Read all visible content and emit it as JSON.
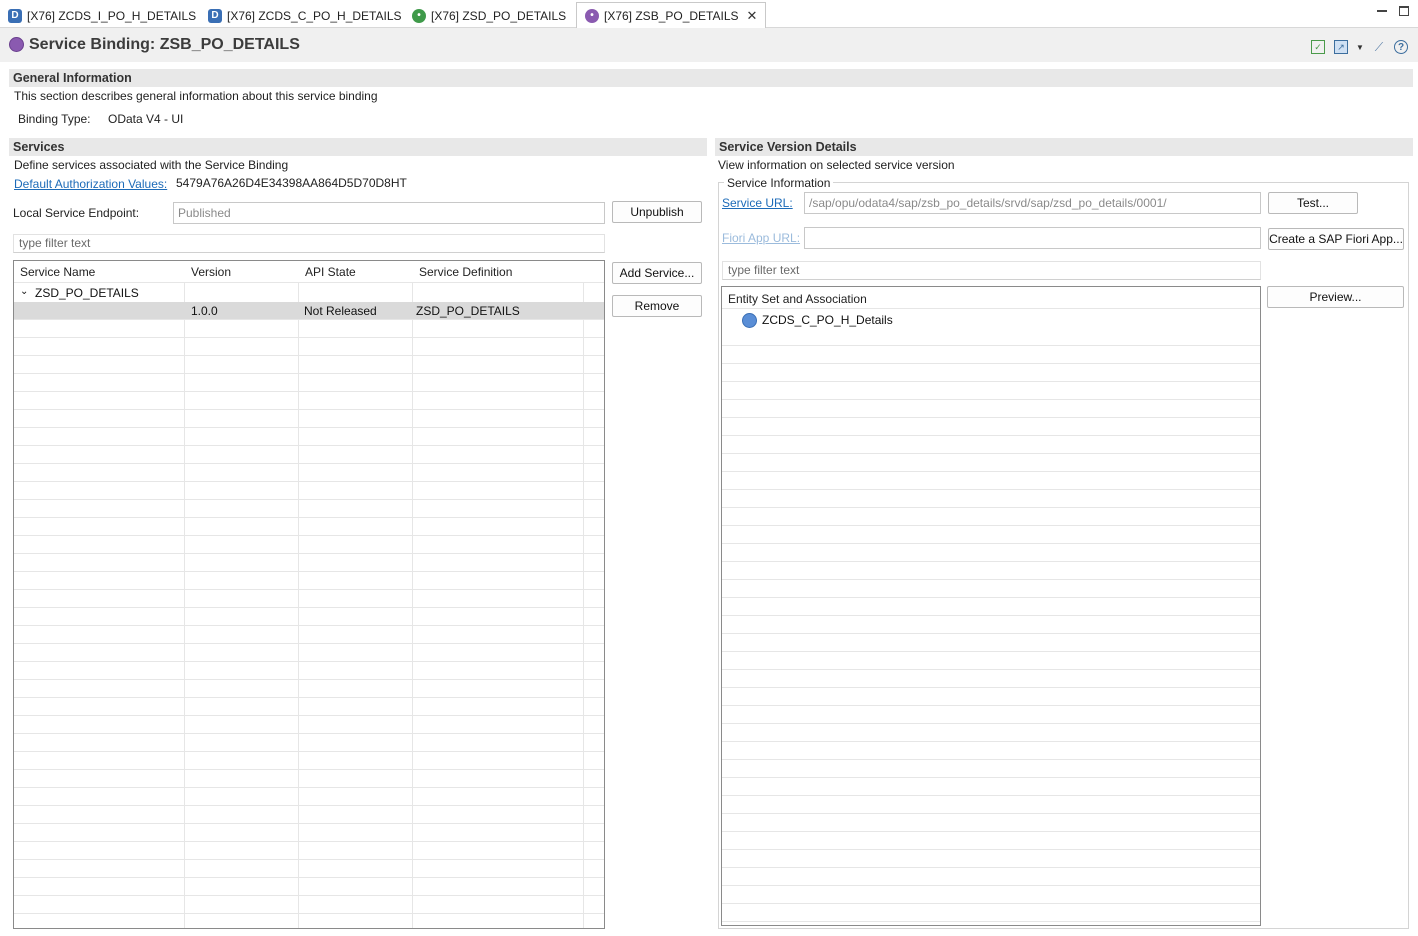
{
  "tabs": [
    {
      "icon": "d",
      "label": "[X76] ZCDS_I_PO_H_DETAILS"
    },
    {
      "icon": "d",
      "label": "[X76] ZCDS_C_PO_H_DETAILS"
    },
    {
      "icon": "g",
      "label": "[X76] ZSD_PO_DETAILS"
    },
    {
      "icon": "p",
      "label": "[X76] ZSB_PO_DETAILS"
    }
  ],
  "editor": {
    "title": "Service Binding: ZSB_PO_DETAILS"
  },
  "general": {
    "header": "General Information",
    "description": "This section describes general information about this service binding",
    "binding_type_label": "Binding Type:",
    "binding_type_value": "OData V4 - UI"
  },
  "services": {
    "header": "Services",
    "description": "Define services associated with the Service Binding",
    "auth_link": "Default Authorization Values:",
    "auth_value": "5479A76A26D4E34398AA864D5D70D8HT",
    "endpoint_label": "Local Service Endpoint:",
    "endpoint_value": "Published",
    "unpublish_label": "Unpublish",
    "filter_placeholder": "type filter text",
    "add_label": "Add Service...",
    "remove_label": "Remove",
    "columns": [
      "Service Name",
      "Version",
      "API State",
      "Service Definition"
    ],
    "group_name": "ZSD_PO_DETAILS",
    "row": {
      "version": "1.0.0",
      "api_state": "Not Released",
      "definition": "ZSD_PO_DETAILS"
    }
  },
  "version_details": {
    "header": "Service Version Details",
    "description": "View information on selected service version",
    "group_label": "Service Information",
    "url_link": "Service URL:",
    "url_value": "/sap/opu/odata4/sap/zsb_po_details/srvd/sap/zsd_po_details/0001/",
    "test_label": "Test...",
    "fiori_link": "Fiori App URL:",
    "fiori_value": "",
    "fiori_button": "Create a SAP Fiori App...",
    "filter_placeholder": "type filter text",
    "entity_header": "Entity Set and Association",
    "entity_item": "ZCDS_C_PO_H_Details",
    "preview_label": "Preview..."
  }
}
